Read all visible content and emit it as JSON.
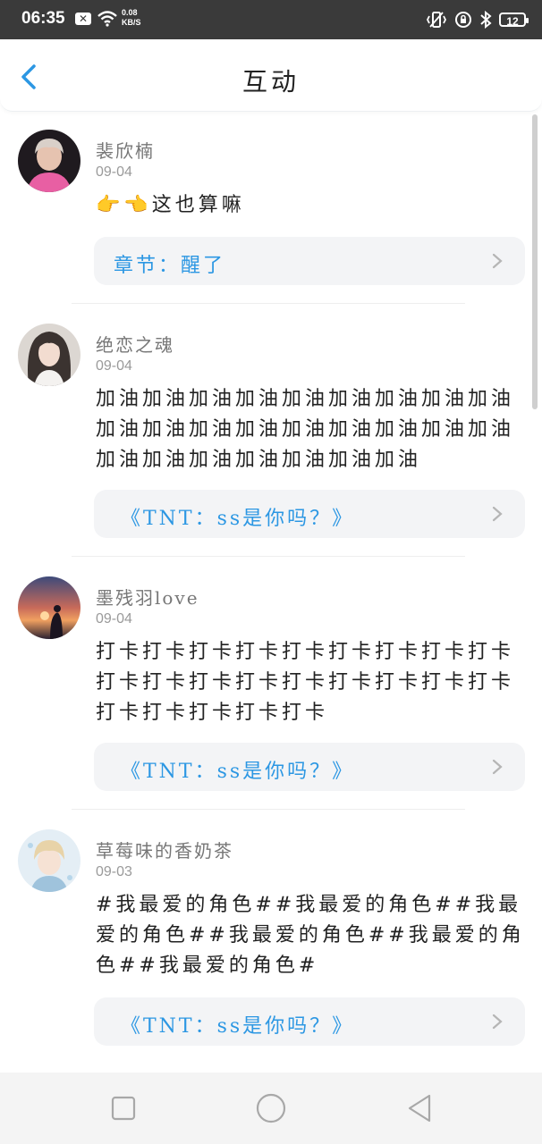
{
  "status_bar": {
    "time": "06:35",
    "speed_value": "0.08",
    "speed_unit": "KB/S",
    "battery": "12"
  },
  "header": {
    "title": "互动"
  },
  "items": [
    {
      "name": "裴欣楠",
      "date": "09-04",
      "text": "这也算嘛",
      "emoji": "👉👈",
      "chapter": "章节：醒了",
      "avatar_color": "#e85fa3"
    },
    {
      "name": "绝恋之魂",
      "date": "09-04",
      "text": "加油加油加油加油加油加油加油加油加油加油加油加油加油加油加油加油加油加油加油加油加油加油加油加油加油",
      "chapter": "《TNT：ss是你吗？》",
      "avatar_color": "#c9c4c0"
    },
    {
      "name": "墨残羽love",
      "date": "09-04",
      "text": "打卡打卡打卡打卡打卡打卡打卡打卡打卡打卡打卡打卡打卡打卡打卡打卡打卡打卡打卡打卡打卡打卡打卡",
      "chapter": "《TNT：ss是你吗？》",
      "avatar_color": "#d66b4e"
    },
    {
      "name": "草莓味的香奶茶",
      "date": "09-03",
      "text": "#我最爱的角色##我最爱的角色##我最爱的角色##我最爱的角色##我最爱的角色##我最爱的角色#",
      "chapter": "《TNT：ss是你吗？》",
      "avatar_color": "#cfe3ef"
    }
  ],
  "colors": {
    "accent": "#2c97e3",
    "status_bar": "#3a3a3a",
    "chip_bg": "#f3f4f6"
  },
  "icons": {
    "back": "chevron-left-icon",
    "chapter": "chevron-right-icon",
    "nav": [
      "square-icon",
      "circle-icon",
      "triangle-back-icon"
    ]
  }
}
